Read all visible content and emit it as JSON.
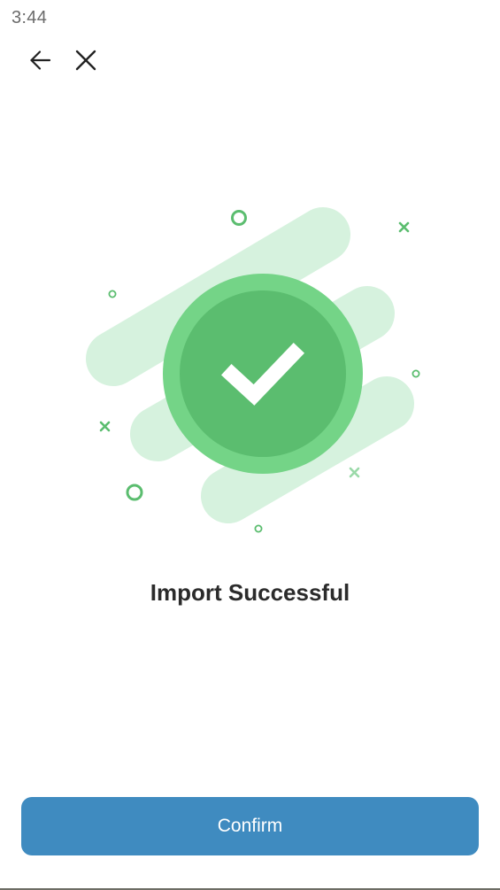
{
  "status_bar": {
    "time": "3:44"
  },
  "nav": {
    "back_icon": "arrow-left-icon",
    "close_icon": "close-icon"
  },
  "illustration": {
    "icon": "checkmark-icon",
    "colors": {
      "outer_ring": "#74d487",
      "inner_circle": "#5bbd6f",
      "stripes": "#d6f2de",
      "decor": "#5bbd6f",
      "decor_light": "#9ad9a8"
    }
  },
  "main": {
    "title": "Import Successful"
  },
  "footer": {
    "confirm_label": "Confirm",
    "confirm_color": "#3f8bc0"
  }
}
